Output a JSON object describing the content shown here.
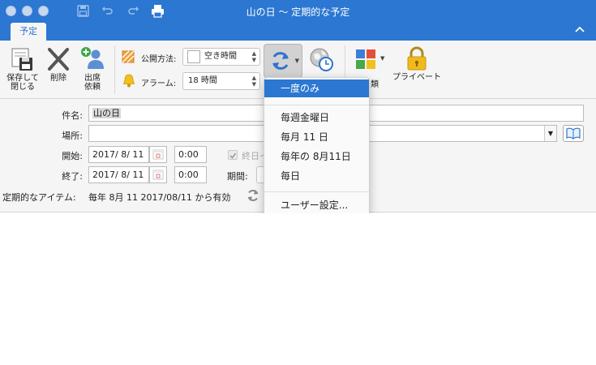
{
  "window": {
    "title": "山の日 〜 定期的な予定",
    "tab_label": "予定",
    "collapse_icon": "chevron-up-icon"
  },
  "ribbon": {
    "save_close_line1": "保存して",
    "save_close_line2": "閉じる",
    "delete_label": "削除",
    "invite_line1": "出席",
    "invite_line2": "依頼",
    "show_as_label": "公開方法:",
    "show_as_value": "空き時間",
    "reminder_label": "アラーム:",
    "reminder_value": "18 時間",
    "categorize_partial": "類",
    "private_label": "プライベート"
  },
  "form": {
    "subject_label": "件名:",
    "subject_value": "山の日",
    "location_label": "場所:",
    "location_value": "",
    "start_label": "開始:",
    "start_date": "2017/  8/ 11",
    "start_time": "0:00",
    "allday_label": "終日イ",
    "end_label": "終了:",
    "end_date": "2017/  8/ 11",
    "end_time": "0:00",
    "duration_label": "期間:",
    "recurrence_label": "定期的なアイテム:",
    "recurrence_text": "毎年 8月 11 2017/08/11 から有効"
  },
  "recurrence_menu": {
    "items": [
      "一度のみ",
      "毎週金曜日",
      "毎月 11 日",
      "毎年の 8月11日",
      "毎日",
      "ユーザー設定..."
    ],
    "selected_index": 0
  },
  "colors": {
    "accent": "#2b77d2",
    "ribbon_bg": "#f5f5f5"
  }
}
